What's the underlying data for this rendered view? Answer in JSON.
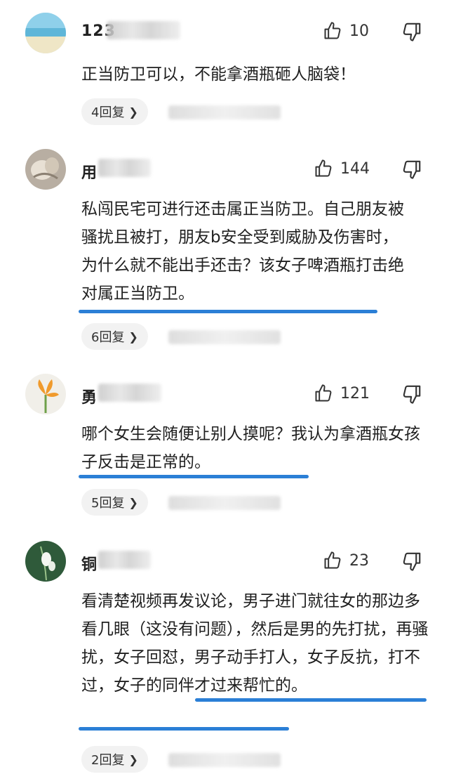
{
  "comments": [
    {
      "username": "123",
      "likes": "10",
      "text": "正当防卫可以，不能拿酒瓶砸人脑袋！",
      "replies": "4回复"
    },
    {
      "username": "用",
      "likes": "144",
      "text": "私闯民宅可进行还击属正当防卫。自己朋友被骚扰且被打，朋友b安全受到威胁及伤害时，为什么就不能出手还击？该女子啤酒瓶打击绝对属正当防卫。",
      "replies": "6回复"
    },
    {
      "username": "勇",
      "likes": "121",
      "text": "哪个女生会随便让别人摸呢？我认为拿酒瓶女孩子反击是正常的。",
      "replies": "5回复"
    },
    {
      "username": "铜",
      "likes": "23",
      "text": "看清楚视频再发议论，男子进门就往女的那边多看几眼（这没有问题），然后是男的先打扰，再骚扰，女子回怼，男子动手打人，女子反抗，打不过，女子的同伴才过来帮忙的。",
      "replies": "2回复"
    }
  ],
  "icons": {
    "like": "thumbs-up-icon",
    "dislike": "thumbs-down-icon",
    "chevron": "chevron-right-icon"
  },
  "colors": {
    "highlight_underline": "#2b7fd6",
    "reply_pill": "#f2f2f2"
  }
}
